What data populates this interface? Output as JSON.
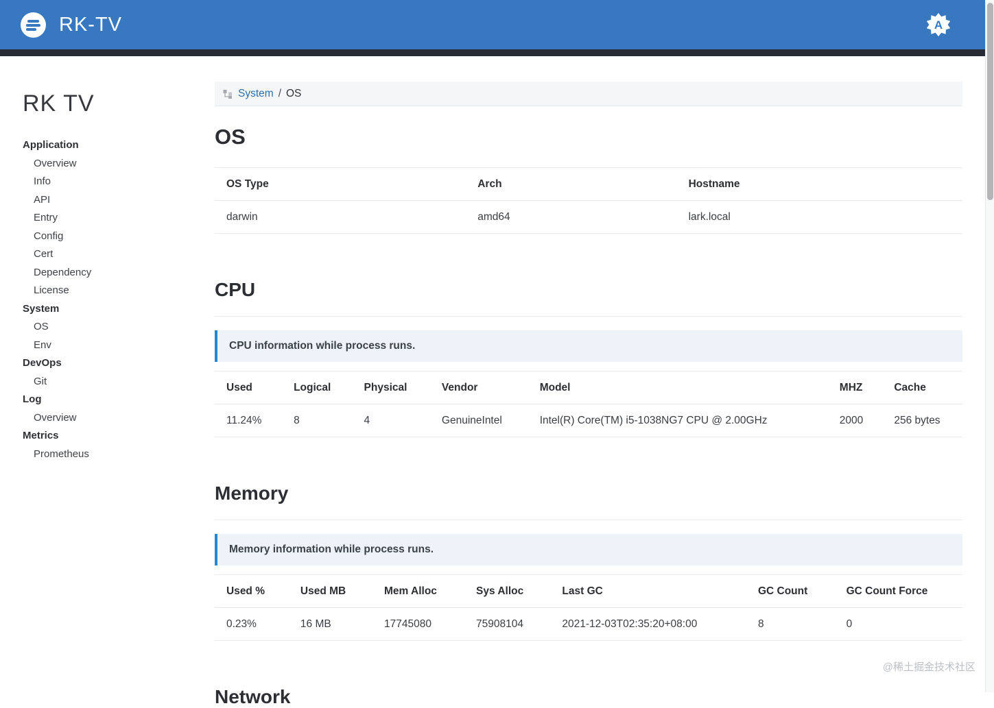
{
  "header": {
    "title": "RK-TV",
    "badge_letter": "A"
  },
  "sidebar": {
    "title": "RK TV",
    "groups": [
      {
        "label": "Application",
        "items": [
          "Overview",
          "Info",
          "API",
          "Entry",
          "Config",
          "Cert",
          "Dependency",
          "License"
        ]
      },
      {
        "label": "System",
        "items": [
          "OS",
          "Env"
        ]
      },
      {
        "label": "DevOps",
        "items": [
          "Git"
        ]
      },
      {
        "label": "Log",
        "items": [
          "Overview"
        ]
      },
      {
        "label": "Metrics",
        "items": [
          "Prometheus"
        ]
      }
    ]
  },
  "breadcrumb": {
    "parent": "System",
    "separator": "/",
    "current": "OS"
  },
  "os_section": {
    "title": "OS",
    "table": {
      "headers": [
        "OS Type",
        "Arch",
        "Hostname"
      ],
      "rows": [
        [
          "darwin",
          "amd64",
          "lark.local"
        ]
      ]
    }
  },
  "cpu_section": {
    "title": "CPU",
    "note": "CPU information while process runs.",
    "table": {
      "headers": [
        "Used",
        "Logical",
        "Physical",
        "Vendor",
        "Model",
        "MHZ",
        "Cache"
      ],
      "rows": [
        [
          "11.24%",
          "8",
          "4",
          "GenuineIntel",
          "Intel(R) Core(TM) i5-1038NG7 CPU @ 2.00GHz",
          "2000",
          "256 bytes"
        ]
      ]
    }
  },
  "memory_section": {
    "title": "Memory",
    "note": "Memory information while process runs.",
    "table": {
      "headers": [
        "Used %",
        "Used MB",
        "Mem Alloc",
        "Sys Alloc",
        "Last GC",
        "GC Count",
        "GC Count Force"
      ],
      "rows": [
        [
          "0.23%",
          "16 MB",
          "17745080",
          "75908104",
          "2021-12-03T02:35:20+08:00",
          "8",
          "0"
        ]
      ]
    }
  },
  "network_section": {
    "title": "Network"
  },
  "watermark": "@稀土掘金技术社区",
  "colors": {
    "navbar_blue": "#3878c0",
    "navbar_dark_strip": "#252a33",
    "link_blue": "#2c6fb0",
    "callout_background": "#edf3f8",
    "callout_border": "#2188d8",
    "breadcrumb_background": "#f4f6f7",
    "table_border": "#ececee",
    "watermark_gray": "#bcbfc6"
  }
}
